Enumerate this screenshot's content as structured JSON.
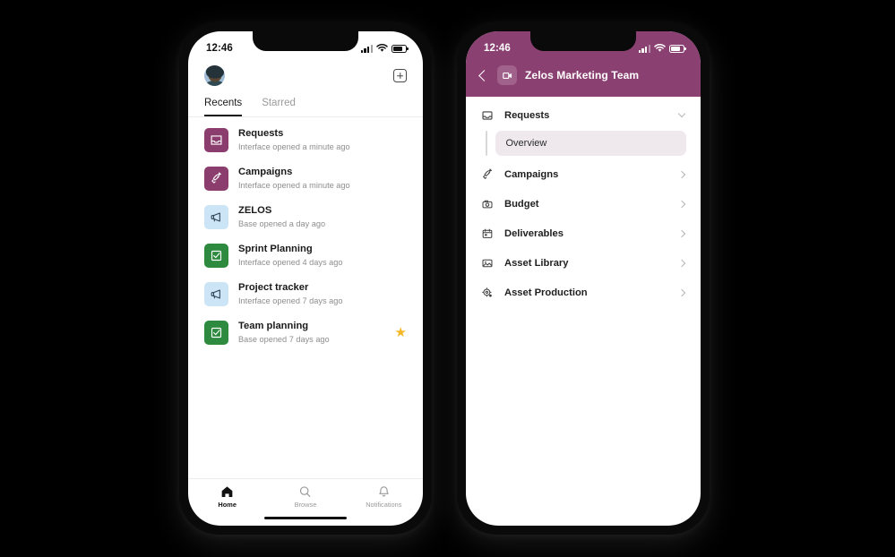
{
  "colors": {
    "header_purple": "#8B4072",
    "tile_purple": "#8B3D6E",
    "tile_blue": "#CCE5F6",
    "tile_green": "#2D8A3E",
    "star_yellow": "#F5B728",
    "selected_row": "#EFE9EE",
    "background": "#000000"
  },
  "left_phone": {
    "status_bar": {
      "time": "12:46",
      "icons": [
        "signal-bars-icon",
        "wifi-icon",
        "battery-icon"
      ]
    },
    "top_bar": {
      "avatar_name": "avatar",
      "add_button": "add-icon"
    },
    "tabs": [
      {
        "label": "Recents",
        "active": true
      },
      {
        "label": "Starred",
        "active": false
      }
    ],
    "items": [
      {
        "title": "Requests",
        "subtitle": "Interface opened a minute ago",
        "icon": "inbox-icon",
        "tile": "purple",
        "starred": false
      },
      {
        "title": "Campaigns",
        "subtitle": "Interface opened a minute ago",
        "icon": "rocket-icon",
        "tile": "purple",
        "starred": false
      },
      {
        "title": "ZELOS",
        "subtitle": "Base opened a day ago",
        "icon": "megaphone-icon",
        "tile": "blue",
        "starred": false
      },
      {
        "title": "Sprint Planning",
        "subtitle": "Interface opened 4 days ago",
        "icon": "checkbox-icon",
        "tile": "green",
        "starred": false
      },
      {
        "title": "Project tracker",
        "subtitle": "Interface opened 7 days ago",
        "icon": "megaphone-icon",
        "tile": "blue",
        "starred": false
      },
      {
        "title": "Team planning",
        "subtitle": "Base opened 7 days ago",
        "icon": "checkbox-icon",
        "tile": "green",
        "starred": true
      }
    ],
    "tab_bar": [
      {
        "label": "Home",
        "icon": "home-icon",
        "active": true
      },
      {
        "label": "Browse",
        "icon": "search-icon",
        "active": false
      },
      {
        "label": "Notifications",
        "icon": "bell-icon",
        "active": false
      }
    ]
  },
  "right_phone": {
    "status_bar": {
      "time": "12:46",
      "icons": [
        "signal-bars-icon",
        "wifi-icon",
        "battery-icon"
      ]
    },
    "nav_header": {
      "back": "back-chevron-icon",
      "badge": "app-badge-icon",
      "title": "Zelos Marketing Team"
    },
    "menu": [
      {
        "label": "Requests",
        "icon": "inbox-icon",
        "chevron": "down"
      },
      {
        "label": "Campaigns",
        "icon": "rocket-icon",
        "chevron": "right"
      },
      {
        "label": "Budget",
        "icon": "budget-icon",
        "chevron": "right"
      },
      {
        "label": "Deliverables",
        "icon": "calendar-icon",
        "chevron": "right"
      },
      {
        "label": "Asset Library",
        "icon": "image-icon",
        "chevron": "right"
      },
      {
        "label": "Asset Production",
        "icon": "asset-production-icon",
        "chevron": "right"
      }
    ],
    "sub_items": [
      {
        "label": "Overview",
        "selected": true
      }
    ]
  }
}
